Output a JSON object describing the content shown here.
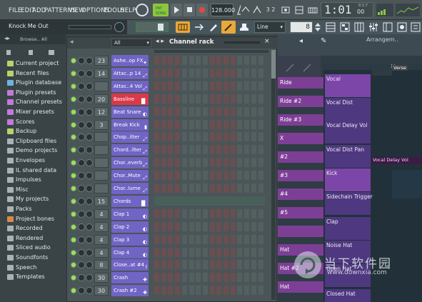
{
  "menu": [
    "FILE",
    "EDIT",
    "ADD",
    "PATTERNS",
    "VIEW",
    "OPTIONS",
    "TOOLS",
    "HELP"
  ],
  "transport": {
    "tempo": "128.000",
    "time": "1:01",
    "time_sub": "00",
    "time_label": "B:S:T"
  },
  "hint": "Knock Me Out",
  "snap": "Line",
  "step": "8",
  "browser": {
    "header": "Browse.. All",
    "items": [
      {
        "label": "Current project",
        "color": "#b8d36a"
      },
      {
        "label": "Recent files",
        "color": "#b8d36a"
      },
      {
        "label": "Plugin database",
        "color": "#6fb3d9"
      },
      {
        "label": "Plugin presets",
        "color": "#c17bd6"
      },
      {
        "label": "Channel presets",
        "color": "#c17bd6"
      },
      {
        "label": "Mixer presets",
        "color": "#c17bd6"
      },
      {
        "label": "Scores",
        "color": "#c17bd6"
      },
      {
        "label": "Backup",
        "color": "#b8d36a"
      },
      {
        "label": "Clipboard files",
        "color": "#aab2b5"
      },
      {
        "label": "Demo projects",
        "color": "#aab2b5"
      },
      {
        "label": "Envelopes",
        "color": "#aab2b5"
      },
      {
        "label": "IL shared data",
        "color": "#aab2b5"
      },
      {
        "label": "Impulses",
        "color": "#aab2b5"
      },
      {
        "label": "Misc",
        "color": "#aab2b5"
      },
      {
        "label": "My projects",
        "color": "#aab2b5"
      },
      {
        "label": "Packs",
        "color": "#aab2b5"
      },
      {
        "label": "Project bones",
        "color": "#d98a4a"
      },
      {
        "label": "Recorded",
        "color": "#aab2b5"
      },
      {
        "label": "Rendered",
        "color": "#aab2b5"
      },
      {
        "label": "Sliced audio",
        "color": "#aab2b5"
      },
      {
        "label": "Soundfonts",
        "color": "#aab2b5"
      },
      {
        "label": "Speech",
        "color": "#aab2b5"
      },
      {
        "label": "Templates",
        "color": "#aab2b5"
      }
    ]
  },
  "rack": {
    "title": "Channel rack",
    "filter": "All",
    "channels": [
      {
        "num": "23",
        "name": "Ashe..op FX",
        "red": false
      },
      {
        "num": "14",
        "name": "Attac..p 14",
        "red": false
      },
      {
        "num": "",
        "name": "Attac..4 Vol",
        "red": false
      },
      {
        "num": "20",
        "name": "Bassline",
        "red": true
      },
      {
        "num": "12",
        "name": "Beat Snare",
        "red": false
      },
      {
        "num": "3",
        "name": "Break Kick",
        "red": false
      },
      {
        "num": "",
        "name": "Chop..ilter",
        "red": false
      },
      {
        "num": "",
        "name": "Chord..ilter",
        "red": false
      },
      {
        "num": "",
        "name": "Chor..everb",
        "red": false
      },
      {
        "num": "",
        "name": "Chor..Mute",
        "red": false
      },
      {
        "num": "",
        "name": "Chor..lume",
        "red": false
      },
      {
        "num": "15",
        "name": "Chords",
        "red": false
      },
      {
        "num": "4",
        "name": "Clap 1",
        "red": false
      },
      {
        "num": "4",
        "name": "Clap 2",
        "red": false
      },
      {
        "num": "4",
        "name": "Clap 3",
        "red": false
      },
      {
        "num": "4",
        "name": "Clap 4",
        "red": false
      },
      {
        "num": "8",
        "name": "Close..at #4",
        "red": false
      },
      {
        "num": "30",
        "name": "Crash",
        "red": false
      },
      {
        "num": "30",
        "name": "Crash #2",
        "red": false
      }
    ]
  },
  "playlist": {
    "title": "Arrangem..",
    "tracks": [
      "Ride",
      "Ride #2",
      "Ride #3",
      "X",
      "#2",
      "#3",
      "#4",
      "#5",
      "",
      "Hat",
      "Hat #2",
      "Hat"
    ],
    "marker": "Verse",
    "bar": "11",
    "lanes": [
      {
        "label": "Vocal"
      },
      {
        "label": "Vocal Dist"
      },
      {
        "label": "Vocal Delay Vol"
      },
      {
        "label": "Vocal Dist Pan"
      },
      {
        "label": "Kick"
      },
      {
        "label": "Sidechain Trigger"
      },
      {
        "label": "Clap"
      },
      {
        "label": "Noise Hat"
      },
      {
        "label": "Open Hat"
      },
      {
        "label": "Closed Hat"
      }
    ],
    "clip_label": "Vocal Delay Vol"
  },
  "watermark": {
    "cn": "当下软件园",
    "en": "www.downxia.com"
  }
}
